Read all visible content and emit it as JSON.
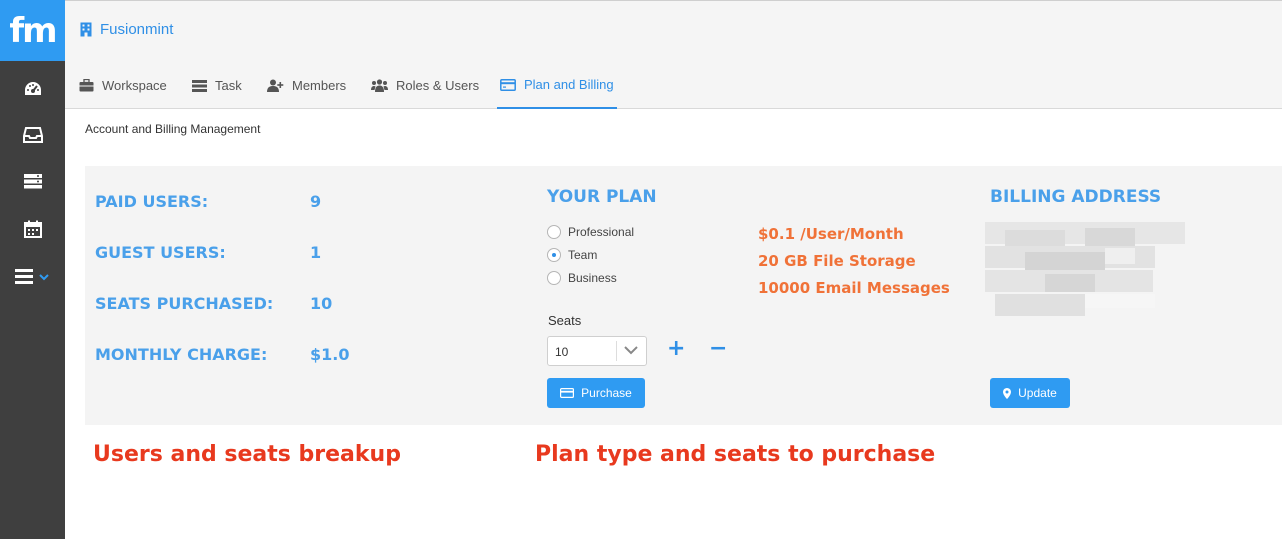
{
  "app": {
    "logo_text": "fm",
    "workspace_name": "Fusionmint",
    "accent": "#2f9bf2",
    "sidebar_bg": "#3f3f3f"
  },
  "sidebar": {
    "icons": [
      "dashboard-icon",
      "inbox-icon",
      "server-icon",
      "calendar-icon",
      "menu-icon"
    ]
  },
  "tabs": [
    {
      "label": "Workspace",
      "icon": "briefcase-icon"
    },
    {
      "label": "Task",
      "icon": "list-icon"
    },
    {
      "label": "Members",
      "icon": "user-plus-icon"
    },
    {
      "label": "Roles & Users",
      "icon": "users-icon"
    },
    {
      "label": "Plan and Billing",
      "icon": "credit-card-icon",
      "active": true
    }
  ],
  "page": {
    "section_title": "Account and Billing Management"
  },
  "stats": [
    {
      "label": "PAID USERS:",
      "value": "9"
    },
    {
      "label": "GUEST USERS:",
      "value": "1"
    },
    {
      "label": "SEATS PURCHASED:",
      "value": "10"
    },
    {
      "label": "MONTHLY CHARGE:",
      "value": "$1.0"
    }
  ],
  "plan": {
    "title": "YOUR PLAN",
    "options": [
      {
        "label": "Professional",
        "selected": false
      },
      {
        "label": "Team",
        "selected": true
      },
      {
        "label": "Business",
        "selected": false
      }
    ],
    "features": [
      "$0.1 /User/Month",
      "20 GB File Storage",
      "10000 Email Messages"
    ],
    "seats_label": "Seats",
    "seats_value": "10",
    "plus": "+",
    "minus": "−",
    "purchase_label": "Purchase"
  },
  "billing": {
    "title": "BILLING ADDRESS",
    "update_label": "Update"
  },
  "annotations": {
    "left": "Users and seats breakup",
    "middle": "Plan type and seats to purchase"
  },
  "colors": {
    "stat_blue": "#4aa0ea",
    "feature_orange": "#f07238",
    "annotation_red": "#e8391e"
  }
}
